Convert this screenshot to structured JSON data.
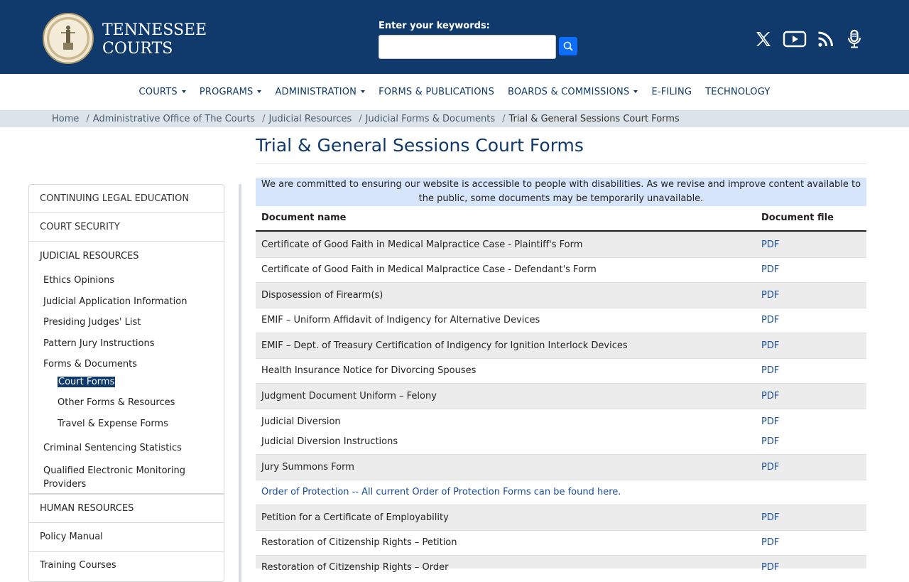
{
  "header": {
    "brand_line1": "TENNESSEE",
    "brand_line2": "COURTS",
    "search_label": "Enter your keywords:",
    "search_value": "",
    "search_placeholder": "",
    "social_icons": [
      "x-icon",
      "youtube-icon",
      "rss-icon",
      "podcast-mic-icon"
    ]
  },
  "nav": {
    "items": [
      {
        "label": "COURTS",
        "dropdown": true
      },
      {
        "label": "PROGRAMS",
        "dropdown": true
      },
      {
        "label": "ADMINISTRATION",
        "dropdown": true
      },
      {
        "label": "FORMS & PUBLICATIONS",
        "dropdown": false
      },
      {
        "label": "BOARDS & COMMISSIONS",
        "dropdown": true
      },
      {
        "label": "E-FILING",
        "dropdown": false
      },
      {
        "label": "TECHNOLOGY",
        "dropdown": false
      }
    ]
  },
  "breadcrumb": {
    "home": "Home",
    "items": [
      "Administrative Office of The Courts",
      "Judicial Resources",
      "Judicial Forms & Documents"
    ],
    "current": "Trial & General Sessions Court Forms",
    "separator": "/"
  },
  "sidebar": {
    "top_items": [
      "CONTINUING LEGAL EDUCATION",
      "COURT SECURITY",
      "JUDICIAL RESOURCES"
    ],
    "sub_items": [
      "Ethics Opinions",
      "Judicial Application Information",
      "Presiding Judges' List",
      "Pattern Jury Instructions",
      "Forms & Documents"
    ],
    "sub_sub_items": [
      "Court Forms",
      "Other Forms & Resources",
      "Travel & Expense Forms"
    ],
    "more_sub_items": [
      "Criminal Sentencing Statistics",
      "Qualified Electronic Monitoring Providers"
    ],
    "bottom_items": [
      "HUMAN RESOURCES",
      "Policy Manual",
      "Training Courses"
    ]
  },
  "main": {
    "title": "Trial & General Sessions Court Forms",
    "notice": "We are committed to ensuring our website is accessible to people with disabilities. As we revise and improve content available to the public, some documents may be temporarily unavailable.",
    "table": {
      "col_name": "Document name",
      "col_file": "Document file",
      "rows": [
        {
          "name": "Certificate of Good Faith in Medical Malpractice Case - Plaintiff's Form",
          "file": "PDF"
        },
        {
          "name": "Certificate of Good Faith in Medical Malpractice Case - Defendant's Form",
          "file": "PDF"
        },
        {
          "name": "Disposession of Firearm(s)",
          "file": "PDF"
        },
        {
          "name": "EMIF – Uniform Affidavit of Indigency for Alternative Devices",
          "file": "PDF"
        },
        {
          "name": "EMIF – Dept. of Treasury Certification of Indigency for Ignition Interlock Devices",
          "file": "PDF"
        },
        {
          "name": "Health Insurance Notice for Divorcing Spouses",
          "file": "PDF"
        },
        {
          "name": "Judgment Document Uniform – Felony",
          "file": "PDF"
        },
        {
          "name": "Judicial Diversion",
          "file": "PDF"
        },
        {
          "name": "Judicial Diversion Instructions",
          "file": "PDF"
        },
        {
          "name": "Jury Summons Form",
          "file": "PDF"
        },
        {
          "name": "Order of Protection -- All current Order of Protection Forms can be found here.",
          "file": ""
        },
        {
          "name": "Petition for a Certificate of Employability",
          "file": "PDF"
        },
        {
          "name": "Restoration of Citizenship Rights – Petition",
          "file": "PDF"
        },
        {
          "name": "Restoration of Citizenship Rights – Order",
          "file": "PDF"
        }
      ]
    }
  },
  "colors": {
    "header_bg": "#0f3a6b",
    "link": "#1a4c9a",
    "notice_bg": "#d7e5fb",
    "search_button": "#0d6efd"
  }
}
